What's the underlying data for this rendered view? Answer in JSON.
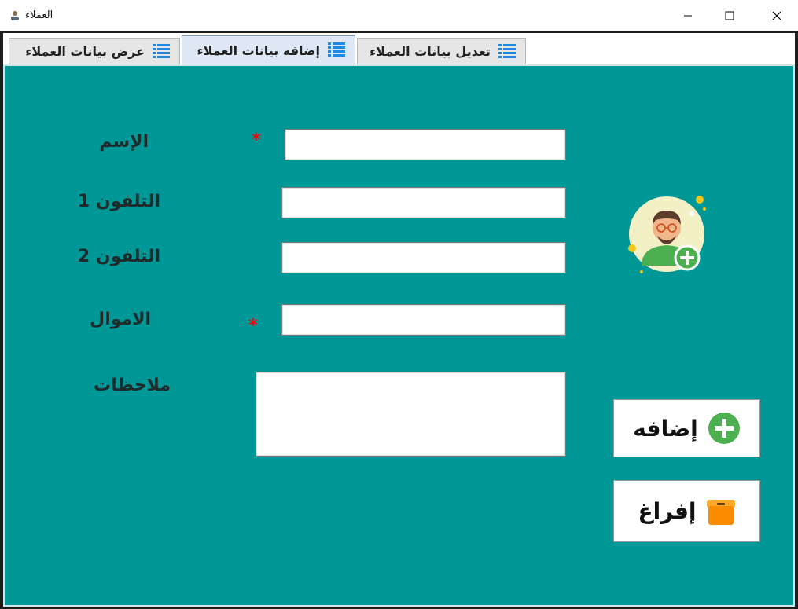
{
  "window": {
    "title": "العملاء"
  },
  "tabs": [
    {
      "label": "عرض بيانات العملاء",
      "active": false
    },
    {
      "label": "إضافه بيانات العملاء",
      "active": true
    },
    {
      "label": "تعديل بيانات العملاء",
      "active": false
    }
  ],
  "form": {
    "name_label": "الإسم",
    "phone1_label": "التلفون 1",
    "phone2_label": "التلفون 2",
    "money_label": "الاموال",
    "notes_label": "ملاحظات",
    "required_mark": "*",
    "name_value": "",
    "phone1_value": "",
    "phone2_value": "",
    "money_value": "",
    "notes_value": ""
  },
  "actions": {
    "add_label": "إضافه",
    "clear_label": "إفراغ"
  },
  "colors": {
    "panel_bg": "#009797",
    "required": "#ff0000",
    "add_icon": "#4caf50",
    "clear_icon": "#ff9800",
    "tab_icon": "#1e88e5"
  },
  "icons": {
    "tab": "list-icon",
    "avatar": "add-user-avatar-icon",
    "add": "plus-circle-icon",
    "clear": "box-icon"
  }
}
